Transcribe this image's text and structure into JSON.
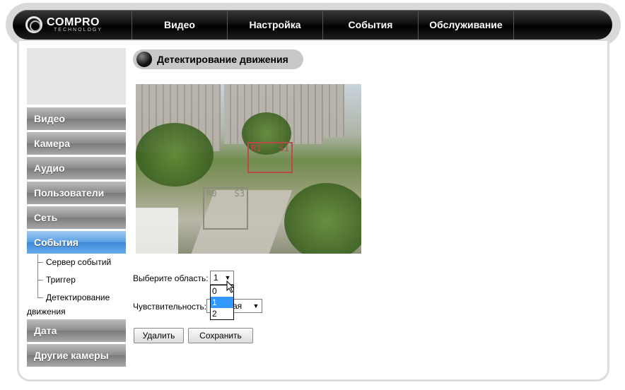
{
  "brand": {
    "name": "COMPRO",
    "sub": "TECHNOLOGY"
  },
  "nav": [
    "Видео",
    "Настройка",
    "События",
    "Обслуживание"
  ],
  "sidebar": {
    "items": [
      {
        "label": "Видео"
      },
      {
        "label": "Камера"
      },
      {
        "label": "Аудио"
      },
      {
        "label": "Пользователи"
      },
      {
        "label": "Сеть"
      },
      {
        "label": "События"
      },
      {
        "label": "Дата"
      },
      {
        "label": "Другие камеры"
      }
    ],
    "subitems": [
      "Сервер событий",
      "Триггер",
      "Детектирование",
      "движения"
    ]
  },
  "section": {
    "title": "Детектирование движения"
  },
  "camera": {
    "zones": [
      {
        "region": "R1",
        "sensitivity": "S1",
        "color": "#b84a4a"
      },
      {
        "region": "R0",
        "sensitivity": "S3",
        "color": "#8a8a80"
      }
    ]
  },
  "form": {
    "area_label": "Выберите область:",
    "area_value": "1",
    "area_options": [
      "0",
      "1",
      "2"
    ],
    "area_selected_option": "1",
    "sensitivity_label": "Чувствительность:",
    "sensitivity_value_visible": "ая",
    "delete_button": "Удалить",
    "save_button": "Сохранить"
  },
  "colors": {
    "active_accent": "#4a93de",
    "selected_option": "#3399ff"
  }
}
